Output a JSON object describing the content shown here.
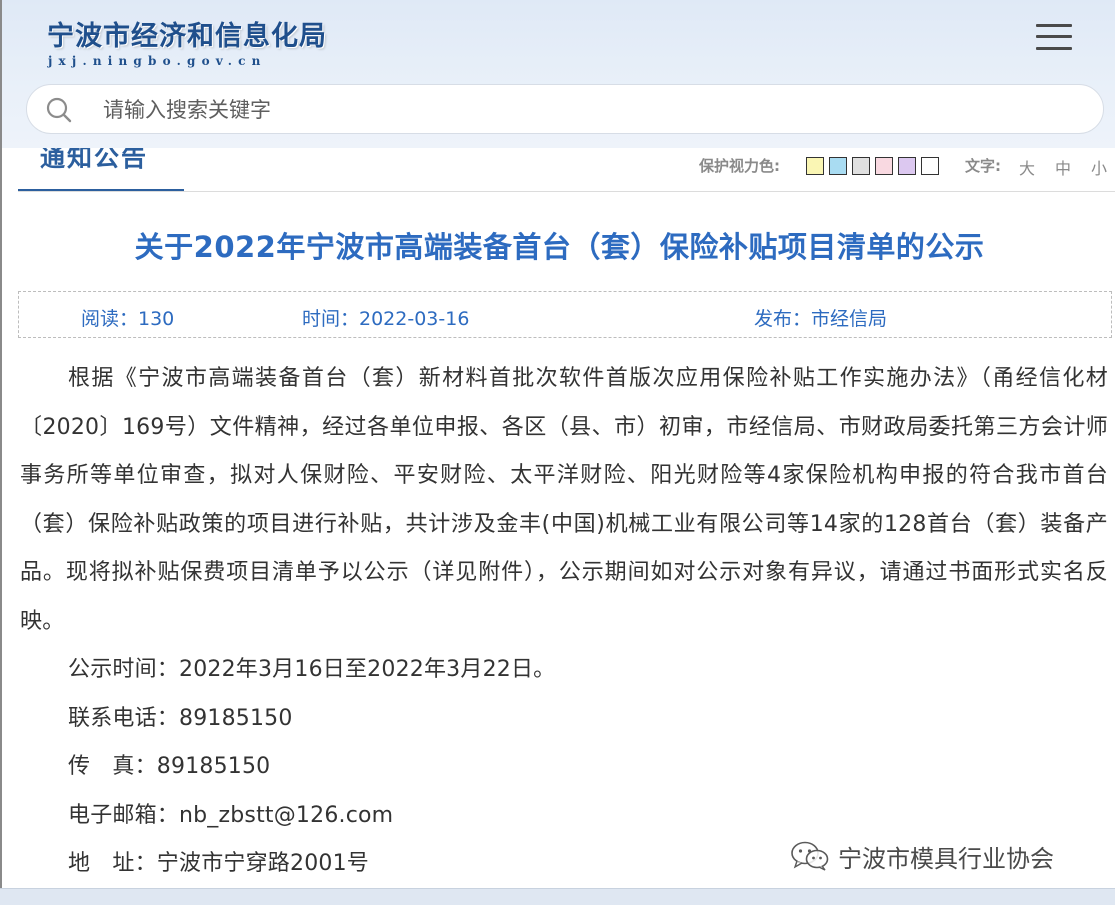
{
  "header": {
    "site_name": "宁波市经济和信息化局",
    "site_domain": "jxj.ningbo.gov.cn"
  },
  "search": {
    "placeholder": "请输入搜索关键字",
    "value": ""
  },
  "section": {
    "tab_label": "通知公告",
    "eye_care_label": "保护视力色:",
    "eye_care_colors": [
      "#faf6b4",
      "#a9dcf2",
      "#e0e0e0",
      "#f9d9e1",
      "#dcc8f0",
      "#ffffff"
    ],
    "text_size_label": "文字:",
    "text_sizes": [
      "大",
      "中",
      "小"
    ]
  },
  "article": {
    "title": "关于2022年宁波市高端装备首台（套）保险补贴项目清单的公示",
    "meta": {
      "views": "阅读：130",
      "time": "时间：2022-03-16",
      "publisher": "发布：市经信局"
    },
    "body": "根据《宁波市高端装备首台（套）新材料首批次软件首版次应用保险补贴工作实施办法》（甬经信化材〔2020〕169号）文件精神，经过各单位申报、各区（县、市）初审，市经信局、市财政局委托第三方会计师事务所等单位审查，拟对人保财险、平安财险、太平洋财险、阳光财险等4家保险机构申报的符合我市首台（套）保险补贴政策的项目进行补贴，共计涉及金丰(中国)机械工业有限公司等14家的128首台（套）装备产品。现将拟补贴保费项目清单予以公示（详见附件），公示期间如对公示对象有异议，请通过书面形式实名反映。",
    "notice_period": "公示时间：2022年3月16日至2022年3月22日。",
    "phone": "联系电话：89185150",
    "fax": "传　真：89185150",
    "email": "电子邮箱：nb_zbstt@126.com",
    "address": "地　址：宁波市宁穿路2001号"
  },
  "watermark": {
    "text": "宁波市模具行业协会",
    "icon": "wechat-icon"
  },
  "colors": {
    "accent": "#2d6bc0",
    "tab": "#2c5f9e",
    "header_bg": "#e4edf8"
  }
}
